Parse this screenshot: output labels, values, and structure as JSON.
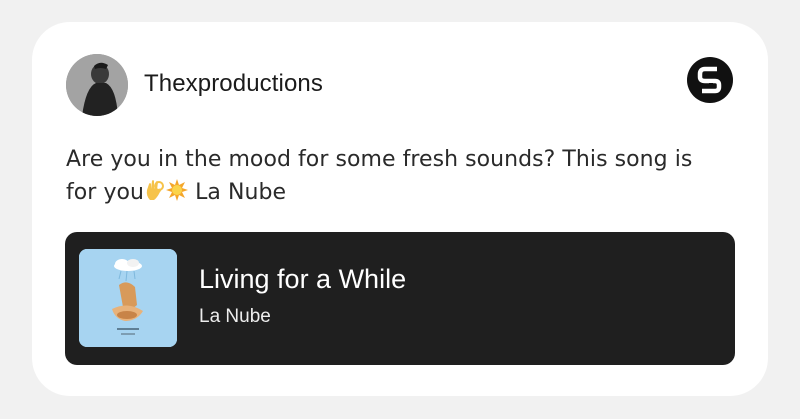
{
  "post": {
    "author": "Thexproductions",
    "text_main": "Are you in the mood for some fresh sounds? This song is for you",
    "emoji_icons": [
      "ok-hand-icon",
      "sun-icon"
    ],
    "text_tail": " La Nube"
  },
  "track": {
    "title": "Living for a While",
    "artist": "La Nube"
  },
  "colors": {
    "page_bg": "#f1f1f1",
    "card_bg": "#ffffff",
    "track_bg": "#1f1f1f",
    "cover_bg": "#a7d4f1"
  }
}
